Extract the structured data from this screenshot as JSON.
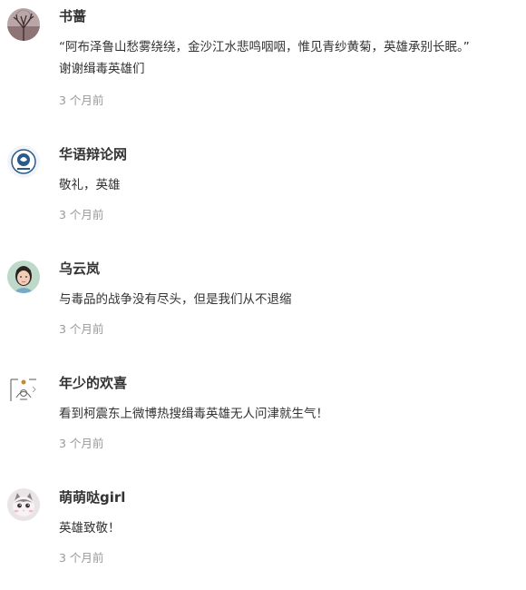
{
  "comments": [
    {
      "username": "书蔷",
      "avatar_icon": "tree-silhouette-avatar-icon",
      "text": "“阿布泽鲁山愁雾绕绕，金沙江水悲鸣咽咽，惟见青纱黄菊，英雄承别长眠。”\n谢谢缉毒英雄们",
      "time": "3 个月前"
    },
    {
      "username": "华语辩论网",
      "avatar_icon": "debate-logo-avatar-icon",
      "text": "敬礼，英雄",
      "time": "3 个月前"
    },
    {
      "username": "乌云岚",
      "avatar_icon": "portrait-avatar-icon",
      "text": "与毒品的战争没有尽头，但是我们从不退缩",
      "time": "3 个月前"
    },
    {
      "username": "年少的欢喜",
      "avatar_icon": "sketch-avatar-icon",
      "text": "看到柯震东上微博热搜缉毒英雄无人问津就生气！",
      "time": "3 个月前"
    },
    {
      "username": "萌萌哒girl",
      "avatar_icon": "cat-avatar-icon",
      "text": "英雄致敬！",
      "time": "3 个月前"
    }
  ]
}
